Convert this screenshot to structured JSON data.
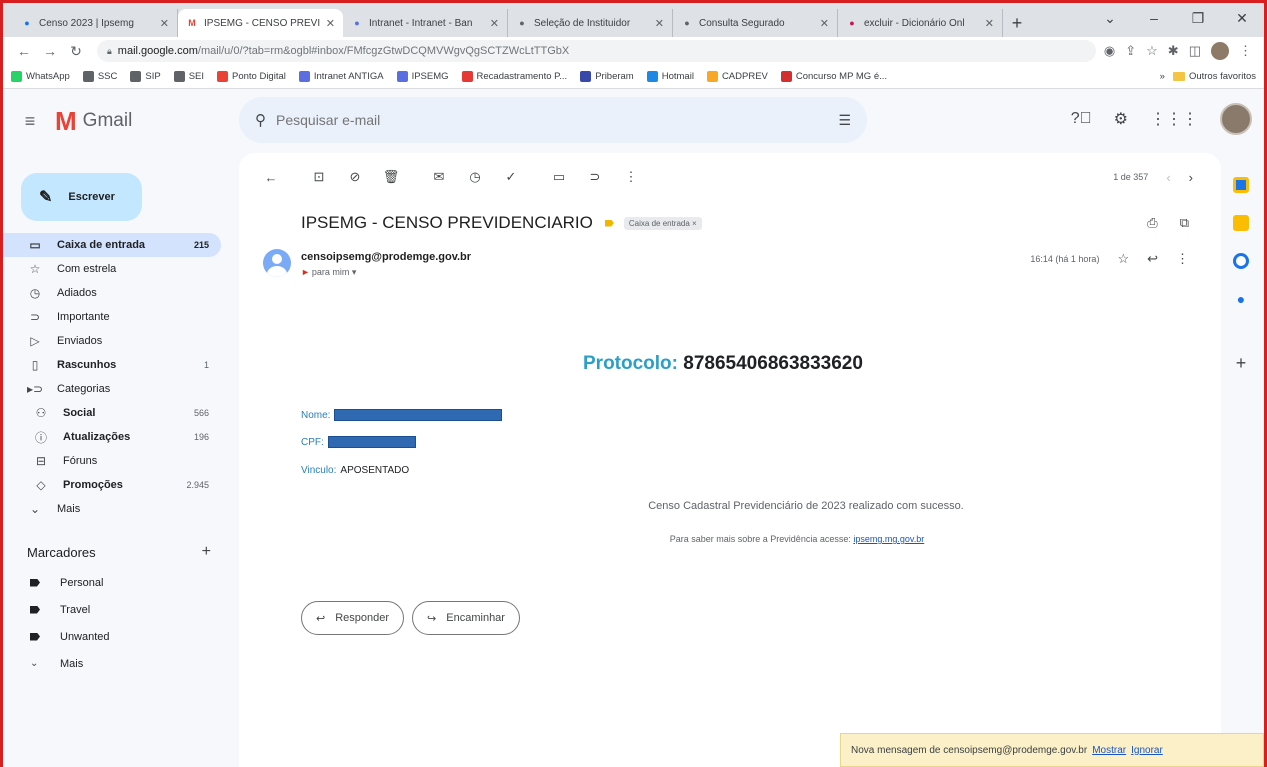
{
  "browser": {
    "tabs": [
      {
        "label": "Censo 2023 | Ipsemg",
        "icon": "circle-icon",
        "color": "#1a73e8",
        "active": false
      },
      {
        "label": "IPSEMG - CENSO PREVI",
        "icon": "gmail-icon",
        "color": "#ea4335",
        "active": true
      },
      {
        "label": "Intranet - Intranet - Ban",
        "icon": "intranet-icon",
        "color": "#5b6ee1",
        "active": false
      },
      {
        "label": "Seleção de Instituidor",
        "icon": "globe-icon",
        "color": "#5f6368",
        "active": false
      },
      {
        "label": "Consulta Segurado",
        "icon": "globe-icon",
        "color": "#5f6368",
        "active": false
      },
      {
        "label": "excluir - Dicionário Onl",
        "icon": "dicio-icon",
        "color": "#c2185b",
        "active": false
      }
    ],
    "new_tab": "+",
    "url_domain": "mail.google.com",
    "url_path": "/mail/u/0/?tab=rm&ogbl#inbox/FMfcgzGtwDCQMVWgvQgSCTZWcLtTTGbX",
    "bookmarks": [
      {
        "label": "WhatsApp",
        "color": "#25d366"
      },
      {
        "label": "SSC",
        "color": "#5f6368"
      },
      {
        "label": "SIP",
        "color": "#5f6368"
      },
      {
        "label": "SEI",
        "color": "#5f6368"
      },
      {
        "label": "Ponto Digital",
        "color": "#ea4335"
      },
      {
        "label": "Intranet ANTIGA",
        "color": "#5b6ee1"
      },
      {
        "label": "IPSEMG",
        "color": "#5b6ee1"
      },
      {
        "label": "Recadastramento P...",
        "color": "#e53935"
      },
      {
        "label": "Priberam",
        "color": "#3949ab"
      },
      {
        "label": "Hotmail",
        "color": "#1e88e5"
      },
      {
        "label": "CADPREV",
        "color": "#f9a825"
      },
      {
        "label": "Concurso MP MG é...",
        "color": "#d32f2f"
      }
    ],
    "other_bookmarks": "Outros favoritos"
  },
  "gmail": {
    "app_name": "Gmail",
    "search_placeholder": "Pesquisar e-mail",
    "compose_label": "Escrever",
    "nav": [
      {
        "label": "Caixa de entrada",
        "count": "215",
        "icon": "inbox-icon",
        "glyph": "▭",
        "active": true,
        "bold": true
      },
      {
        "label": "Com estrela",
        "count": "",
        "icon": "star-icon",
        "glyph": "☆",
        "active": false,
        "bold": false
      },
      {
        "label": "Adiados",
        "count": "",
        "icon": "clock-icon",
        "glyph": "◷",
        "active": false,
        "bold": false
      },
      {
        "label": "Importante",
        "count": "",
        "icon": "important-icon",
        "glyph": "⊃",
        "active": false,
        "bold": false
      },
      {
        "label": "Enviados",
        "count": "",
        "icon": "send-icon",
        "glyph": "▷",
        "active": false,
        "bold": false
      },
      {
        "label": "Rascunhos",
        "count": "1",
        "icon": "draft-icon",
        "glyph": "▯",
        "active": false,
        "bold": true
      },
      {
        "label": "Categorias",
        "count": "",
        "icon": "label-icon",
        "glyph": "▸⊃",
        "active": false,
        "bold": false
      },
      {
        "label": "Social",
        "count": "566",
        "icon": "people-icon",
        "glyph": "⚇",
        "active": false,
        "bold": true,
        "sub": true
      },
      {
        "label": "Atualizações",
        "count": "196",
        "icon": "info-icon",
        "glyph": "ⓘ",
        "active": false,
        "bold": true,
        "sub": true
      },
      {
        "label": "Fóruns",
        "count": "",
        "icon": "forum-icon",
        "glyph": "⊟",
        "active": false,
        "bold": false,
        "sub": true
      },
      {
        "label": "Promoções",
        "count": "2.945",
        "icon": "tag-icon",
        "glyph": "◇",
        "active": false,
        "bold": true,
        "sub": true
      },
      {
        "label": "Mais",
        "count": "",
        "icon": "chevron-down-icon",
        "glyph": "⌄",
        "active": false,
        "bold": false
      }
    ],
    "labels_title": "Marcadores",
    "labels": [
      {
        "label": "Personal"
      },
      {
        "label": "Travel"
      },
      {
        "label": "Unwanted"
      }
    ],
    "labels_more": "Mais"
  },
  "email": {
    "pager": "1 de 357",
    "subject": "IPSEMG - CENSO PREVIDENCIARIO",
    "inbox_chip": "Caixa de entrada ×",
    "sender": "censoipsemg@prodemge.gov.br",
    "to": "para mim ▾",
    "time": "16:14 (há 1 hora)",
    "protocol_label": "Protocolo:",
    "protocol_number": "87865406863833620",
    "name_label": "Nome:",
    "cpf_label": "CPF:",
    "vinculo_label": "Vinculo:",
    "vinculo_value": "APOSENTADO",
    "success_msg": "Censo Cadastral Previdenciário de 2023 realizado com sucesso.",
    "more_info": "Para saber mais sobre a Previdência acesse:",
    "more_link": "ipsemg.mg.gov.br",
    "reply_label": "Responder",
    "forward_label": "Encaminhar"
  },
  "notification": {
    "text": "Nova mensagem de censoipsemg@prodemge.gov.br",
    "show": "Mostrar",
    "ignore": "Ignorar"
  },
  "colors": {
    "accent": "#2a9fc7",
    "frame": "#d81e1e",
    "selected": "#d3e3fd"
  }
}
